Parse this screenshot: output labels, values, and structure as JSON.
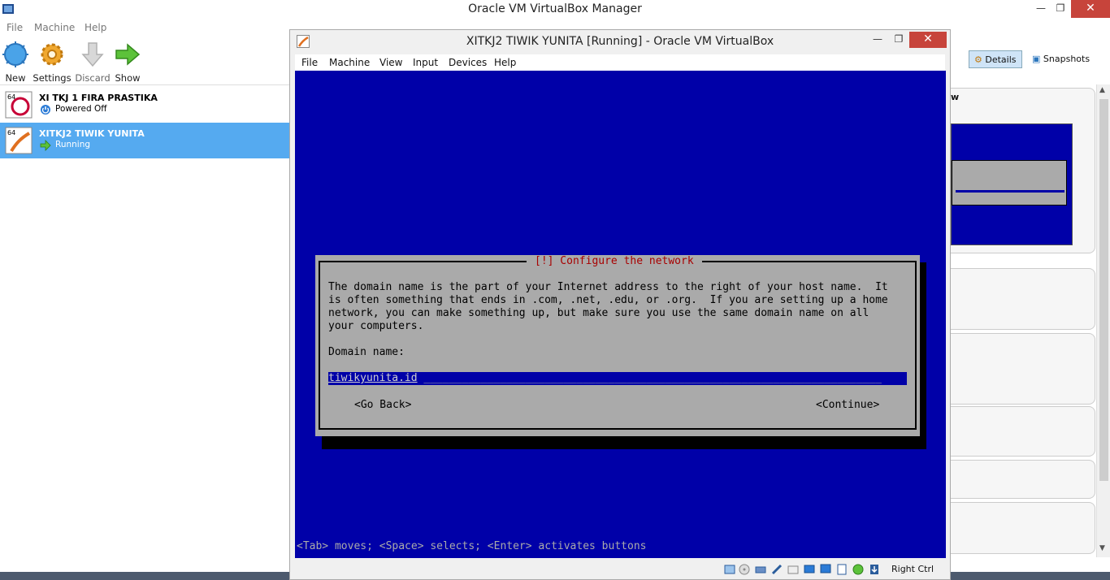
{
  "manager": {
    "title": "Oracle VM VirtualBox Manager",
    "menu": [
      "File",
      "Machine",
      "Help"
    ],
    "toolbar": {
      "new": "New",
      "settings": "Settings",
      "discard": "Discard",
      "show": "Show"
    },
    "vms": [
      {
        "name": "XI TKJ 1 FIRA PRASTIKA",
        "state": "Powered Off",
        "selected": false
      },
      {
        "name": "XITKJ2 TIWIK YUNITA",
        "state": "Running",
        "selected": true
      }
    ],
    "details_tab": "Details",
    "snapshots_tab": "Snapshots",
    "preview_partial_label": "w"
  },
  "vm_window": {
    "title": "XITKJ2 TIWIK YUNITA [Running] - Oracle VM VirtualBox",
    "menu": [
      "File",
      "Machine",
      "View",
      "Input",
      "Devices",
      "Help"
    ],
    "dialog": {
      "title": "[!] Configure the network",
      "body": "The domain name is the part of your Internet address to the right of your host name.  It\nis often something that ends in .com, .net, .edu, or .org.  If you are setting up a home\nnetwork, you can make something up, but make sure you use the same domain name on all\nyour computers.",
      "label": "Domain name:",
      "input_value": "tiwikyunita.id",
      "back_button": "<Go Back>",
      "continue_button": "<Continue>"
    },
    "hint": "<Tab> moves; <Space> selects; <Enter> activates buttons",
    "host_key": "Right Ctrl"
  },
  "colors": {
    "installer_blue": "#0000a8",
    "dialog_gray": "#aaaaaa",
    "dialog_title_red": "#a80000",
    "selection_blue": "#55aaf0",
    "close_red": "#c7443b"
  }
}
